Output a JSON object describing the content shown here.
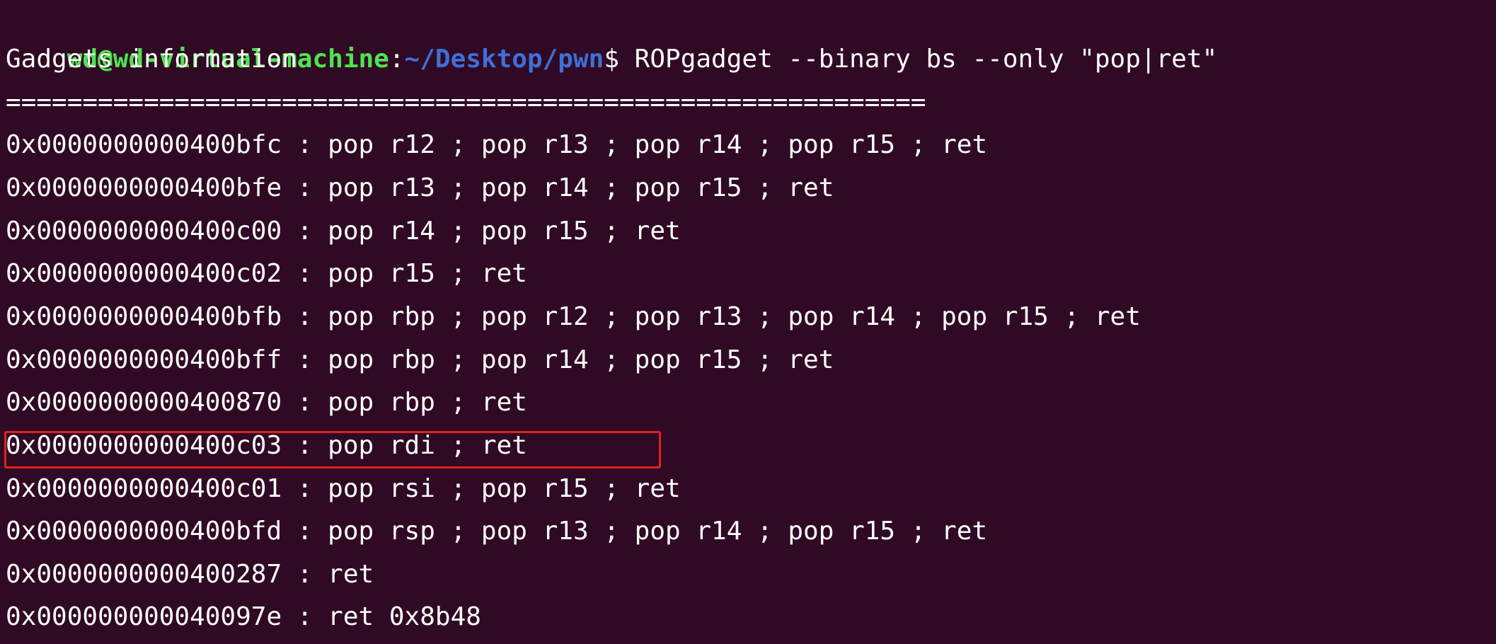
{
  "terminal": {
    "prompt": {
      "user_host": "wd@wd-virtual-machine",
      "separator": ":",
      "path": "~/Desktop/pwn",
      "symbol": "$ ",
      "command": "ROPgadget --binary bs --only \"pop|ret\""
    },
    "header": "Gadgets information",
    "divider": "============================================================",
    "gadgets": [
      {
        "address": "0x0000000000400bfc",
        "instructions": "pop r12 ; pop r13 ; pop r14 ; pop r15 ; ret"
      },
      {
        "address": "0x0000000000400bfe",
        "instructions": "pop r13 ; pop r14 ; pop r15 ; ret"
      },
      {
        "address": "0x0000000000400c00",
        "instructions": "pop r14 ; pop r15 ; ret"
      },
      {
        "address": "0x0000000000400c02",
        "instructions": "pop r15 ; ret"
      },
      {
        "address": "0x0000000000400bfb",
        "instructions": "pop rbp ; pop r12 ; pop r13 ; pop r14 ; pop r15 ; ret"
      },
      {
        "address": "0x0000000000400bff",
        "instructions": "pop rbp ; pop r14 ; pop r15 ; ret"
      },
      {
        "address": "0x0000000000400870",
        "instructions": "pop rbp ; ret"
      },
      {
        "address": "0x0000000000400c03",
        "instructions": "pop rdi ; ret",
        "highlighted": true
      },
      {
        "address": "0x0000000000400c01",
        "instructions": "pop rsi ; pop r15 ; ret"
      },
      {
        "address": "0x0000000000400bfd",
        "instructions": "pop rsp ; pop r13 ; pop r14 ; pop r15 ; ret"
      },
      {
        "address": "0x0000000000400287",
        "instructions": "ret"
      },
      {
        "address": "0x000000000040097e",
        "instructions": "ret 0x8b48"
      }
    ],
    "separator_text": " : ",
    "colors": {
      "background": "#300a24",
      "text": "#ffffff",
      "prompt_user": "#4ee44e",
      "prompt_path": "#3f6fd8",
      "highlight": "#e02020"
    }
  }
}
